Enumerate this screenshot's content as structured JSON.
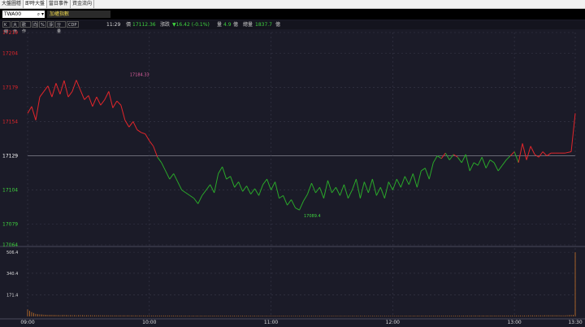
{
  "tabs": [
    "大盤圖穩",
    "即時大盤",
    "當日事件",
    "資金流向"
  ],
  "active_tab": 1,
  "toolbar": {
    "symbol": "TWA00",
    "search_icon": "magnifier-icon",
    "index_name": "加權指數"
  },
  "buttons": [
    "K線",
    "大示",
    "歡作",
    "向",
    "%",
    "淨",
    "分量",
    "CDP"
  ],
  "info": {
    "time": "11:29",
    "price_label": "價",
    "price": "17112.36",
    "change_label": "漲跌",
    "change": "▼16.42 (-0.1%)",
    "volume_label": "量",
    "volume": "4.9",
    "volume_unit": "億",
    "total_label": "總量",
    "total": "1837.7",
    "total_unit": "億"
  },
  "colors": {
    "up": "#e3262b",
    "down": "#2aa82a",
    "volume": "#c8742a",
    "ref": "#ffffff",
    "grid": "#3a3a4a"
  },
  "chart_data": {
    "type": "line",
    "x_ticks": [
      "09:00",
      "10:00",
      "11:00",
      "12:00",
      "13:00",
      "13:30"
    ],
    "y_ticks": [
      17219,
      17204,
      17179,
      17154,
      17129,
      17104,
      17079,
      17064
    ],
    "reference": 17129,
    "ylim": [
      17064,
      17219
    ],
    "x_range_min": [
      0,
      270
    ],
    "high": {
      "value": 17184.33,
      "label": "17184.33",
      "t": 40
    },
    "low": {
      "value": 17089.4,
      "label": "17089.4",
      "t": 133
    },
    "series_points": [
      [
        0,
        17160
      ],
      [
        2,
        17165
      ],
      [
        4,
        17155
      ],
      [
        6,
        17172
      ],
      [
        8,
        17176
      ],
      [
        10,
        17180
      ],
      [
        12,
        17172
      ],
      [
        14,
        17182
      ],
      [
        16,
        17174
      ],
      [
        18,
        17184
      ],
      [
        20,
        17172
      ],
      [
        22,
        17176
      ],
      [
        24,
        17184.33
      ],
      [
        26,
        17177
      ],
      [
        28,
        17170
      ],
      [
        30,
        17173
      ],
      [
        32,
        17165
      ],
      [
        34,
        17172
      ],
      [
        36,
        17166
      ],
      [
        38,
        17170
      ],
      [
        40,
        17176
      ],
      [
        42,
        17164
      ],
      [
        44,
        17169
      ],
      [
        46,
        17166
      ],
      [
        48,
        17155
      ],
      [
        50,
        17150
      ],
      [
        52,
        17154
      ],
      [
        54,
        17148
      ],
      [
        56,
        17146
      ],
      [
        58,
        17145
      ],
      [
        60,
        17140
      ],
      [
        62,
        17136
      ],
      [
        64,
        17128
      ],
      [
        66,
        17124
      ],
      [
        68,
        17118
      ],
      [
        70,
        17112
      ],
      [
        72,
        17116
      ],
      [
        74,
        17110
      ],
      [
        76,
        17104
      ],
      [
        78,
        17102
      ],
      [
        80,
        17100
      ],
      [
        82,
        17098
      ],
      [
        84,
        17094
      ],
      [
        86,
        17100
      ],
      [
        88,
        17104
      ],
      [
        90,
        17108
      ],
      [
        92,
        17102
      ],
      [
        94,
        17116
      ],
      [
        96,
        17121
      ],
      [
        98,
        17112
      ],
      [
        100,
        17114
      ],
      [
        102,
        17106
      ],
      [
        104,
        17110
      ],
      [
        106,
        17103
      ],
      [
        108,
        17107
      ],
      [
        110,
        17101
      ],
      [
        112,
        17105
      ],
      [
        114,
        17100
      ],
      [
        116,
        17108
      ],
      [
        118,
        17112
      ],
      [
        120,
        17104
      ],
      [
        122,
        17110
      ],
      [
        124,
        17098
      ],
      [
        126,
        17100
      ],
      [
        128,
        17093
      ],
      [
        130,
        17097
      ],
      [
        132,
        17091
      ],
      [
        134,
        17089.4
      ],
      [
        136,
        17096
      ],
      [
        138,
        17101
      ],
      [
        140,
        17109
      ],
      [
        142,
        17102
      ],
      [
        144,
        17106
      ],
      [
        146,
        17098
      ],
      [
        148,
        17111
      ],
      [
        150,
        17102
      ],
      [
        152,
        17106
      ],
      [
        154,
        17100
      ],
      [
        156,
        17108
      ],
      [
        158,
        17098
      ],
      [
        160,
        17104
      ],
      [
        162,
        17112
      ],
      [
        164,
        17098
      ],
      [
        166,
        17110
      ],
      [
        168,
        17102
      ],
      [
        170,
        17112
      ],
      [
        172,
        17100
      ],
      [
        174,
        17106
      ],
      [
        176,
        17098
      ],
      [
        178,
        17110
      ],
      [
        180,
        17104
      ],
      [
        182,
        17112
      ],
      [
        184,
        17106
      ],
      [
        186,
        17114
      ],
      [
        188,
        17108
      ],
      [
        190,
        17116
      ],
      [
        192,
        17106
      ],
      [
        194,
        17118
      ],
      [
        196,
        17120
      ],
      [
        198,
        17112
      ],
      [
        200,
        17124
      ],
      [
        202,
        17129
      ],
      [
        204,
        17127
      ],
      [
        206,
        17131
      ],
      [
        208,
        17126
      ],
      [
        210,
        17130
      ],
      [
        212,
        17128
      ],
      [
        214,
        17124
      ],
      [
        216,
        17130
      ],
      [
        218,
        17118
      ],
      [
        220,
        17124
      ],
      [
        222,
        17122
      ],
      [
        224,
        17128
      ],
      [
        226,
        17120
      ],
      [
        228,
        17126
      ],
      [
        230,
        17124
      ],
      [
        232,
        17118
      ],
      [
        234,
        17122
      ],
      [
        236,
        17126
      ],
      [
        238,
        17129
      ],
      [
        240,
        17132
      ],
      [
        242,
        17124
      ],
      [
        244,
        17138
      ],
      [
        246,
        17126
      ],
      [
        248,
        17136
      ],
      [
        250,
        17130
      ],
      [
        252,
        17128
      ],
      [
        254,
        17132
      ],
      [
        256,
        17129
      ],
      [
        258,
        17131
      ],
      [
        260,
        17131
      ],
      [
        262,
        17131
      ],
      [
        265,
        17131
      ],
      [
        268,
        17132
      ],
      [
        270,
        17160
      ]
    ],
    "volume_ticks": [
      171.4,
      340.4,
      506.4
    ],
    "volume": [
      [
        0,
        55
      ],
      [
        2,
        34
      ],
      [
        4,
        20
      ],
      [
        6,
        16
      ],
      [
        8,
        14
      ],
      [
        10,
        12
      ],
      [
        12,
        12
      ],
      [
        14,
        11
      ],
      [
        16,
        10
      ],
      [
        18,
        11
      ],
      [
        20,
        10
      ],
      [
        22,
        10
      ],
      [
        24,
        9
      ],
      [
        26,
        10
      ],
      [
        28,
        9
      ],
      [
        30,
        9
      ],
      [
        40,
        8
      ],
      [
        50,
        8
      ],
      [
        60,
        7
      ],
      [
        70,
        7
      ],
      [
        80,
        6
      ],
      [
        90,
        6
      ],
      [
        100,
        6
      ],
      [
        110,
        6
      ],
      [
        120,
        6
      ],
      [
        130,
        5
      ],
      [
        140,
        5
      ],
      [
        150,
        5
      ],
      [
        160,
        5
      ],
      [
        170,
        5
      ],
      [
        180,
        5
      ],
      [
        190,
        6
      ],
      [
        200,
        6
      ],
      [
        210,
        6
      ],
      [
        220,
        7
      ],
      [
        230,
        7
      ],
      [
        240,
        7
      ],
      [
        250,
        8
      ],
      [
        260,
        9
      ],
      [
        265,
        8
      ],
      [
        268,
        12
      ],
      [
        270,
        506.4
      ]
    ]
  }
}
